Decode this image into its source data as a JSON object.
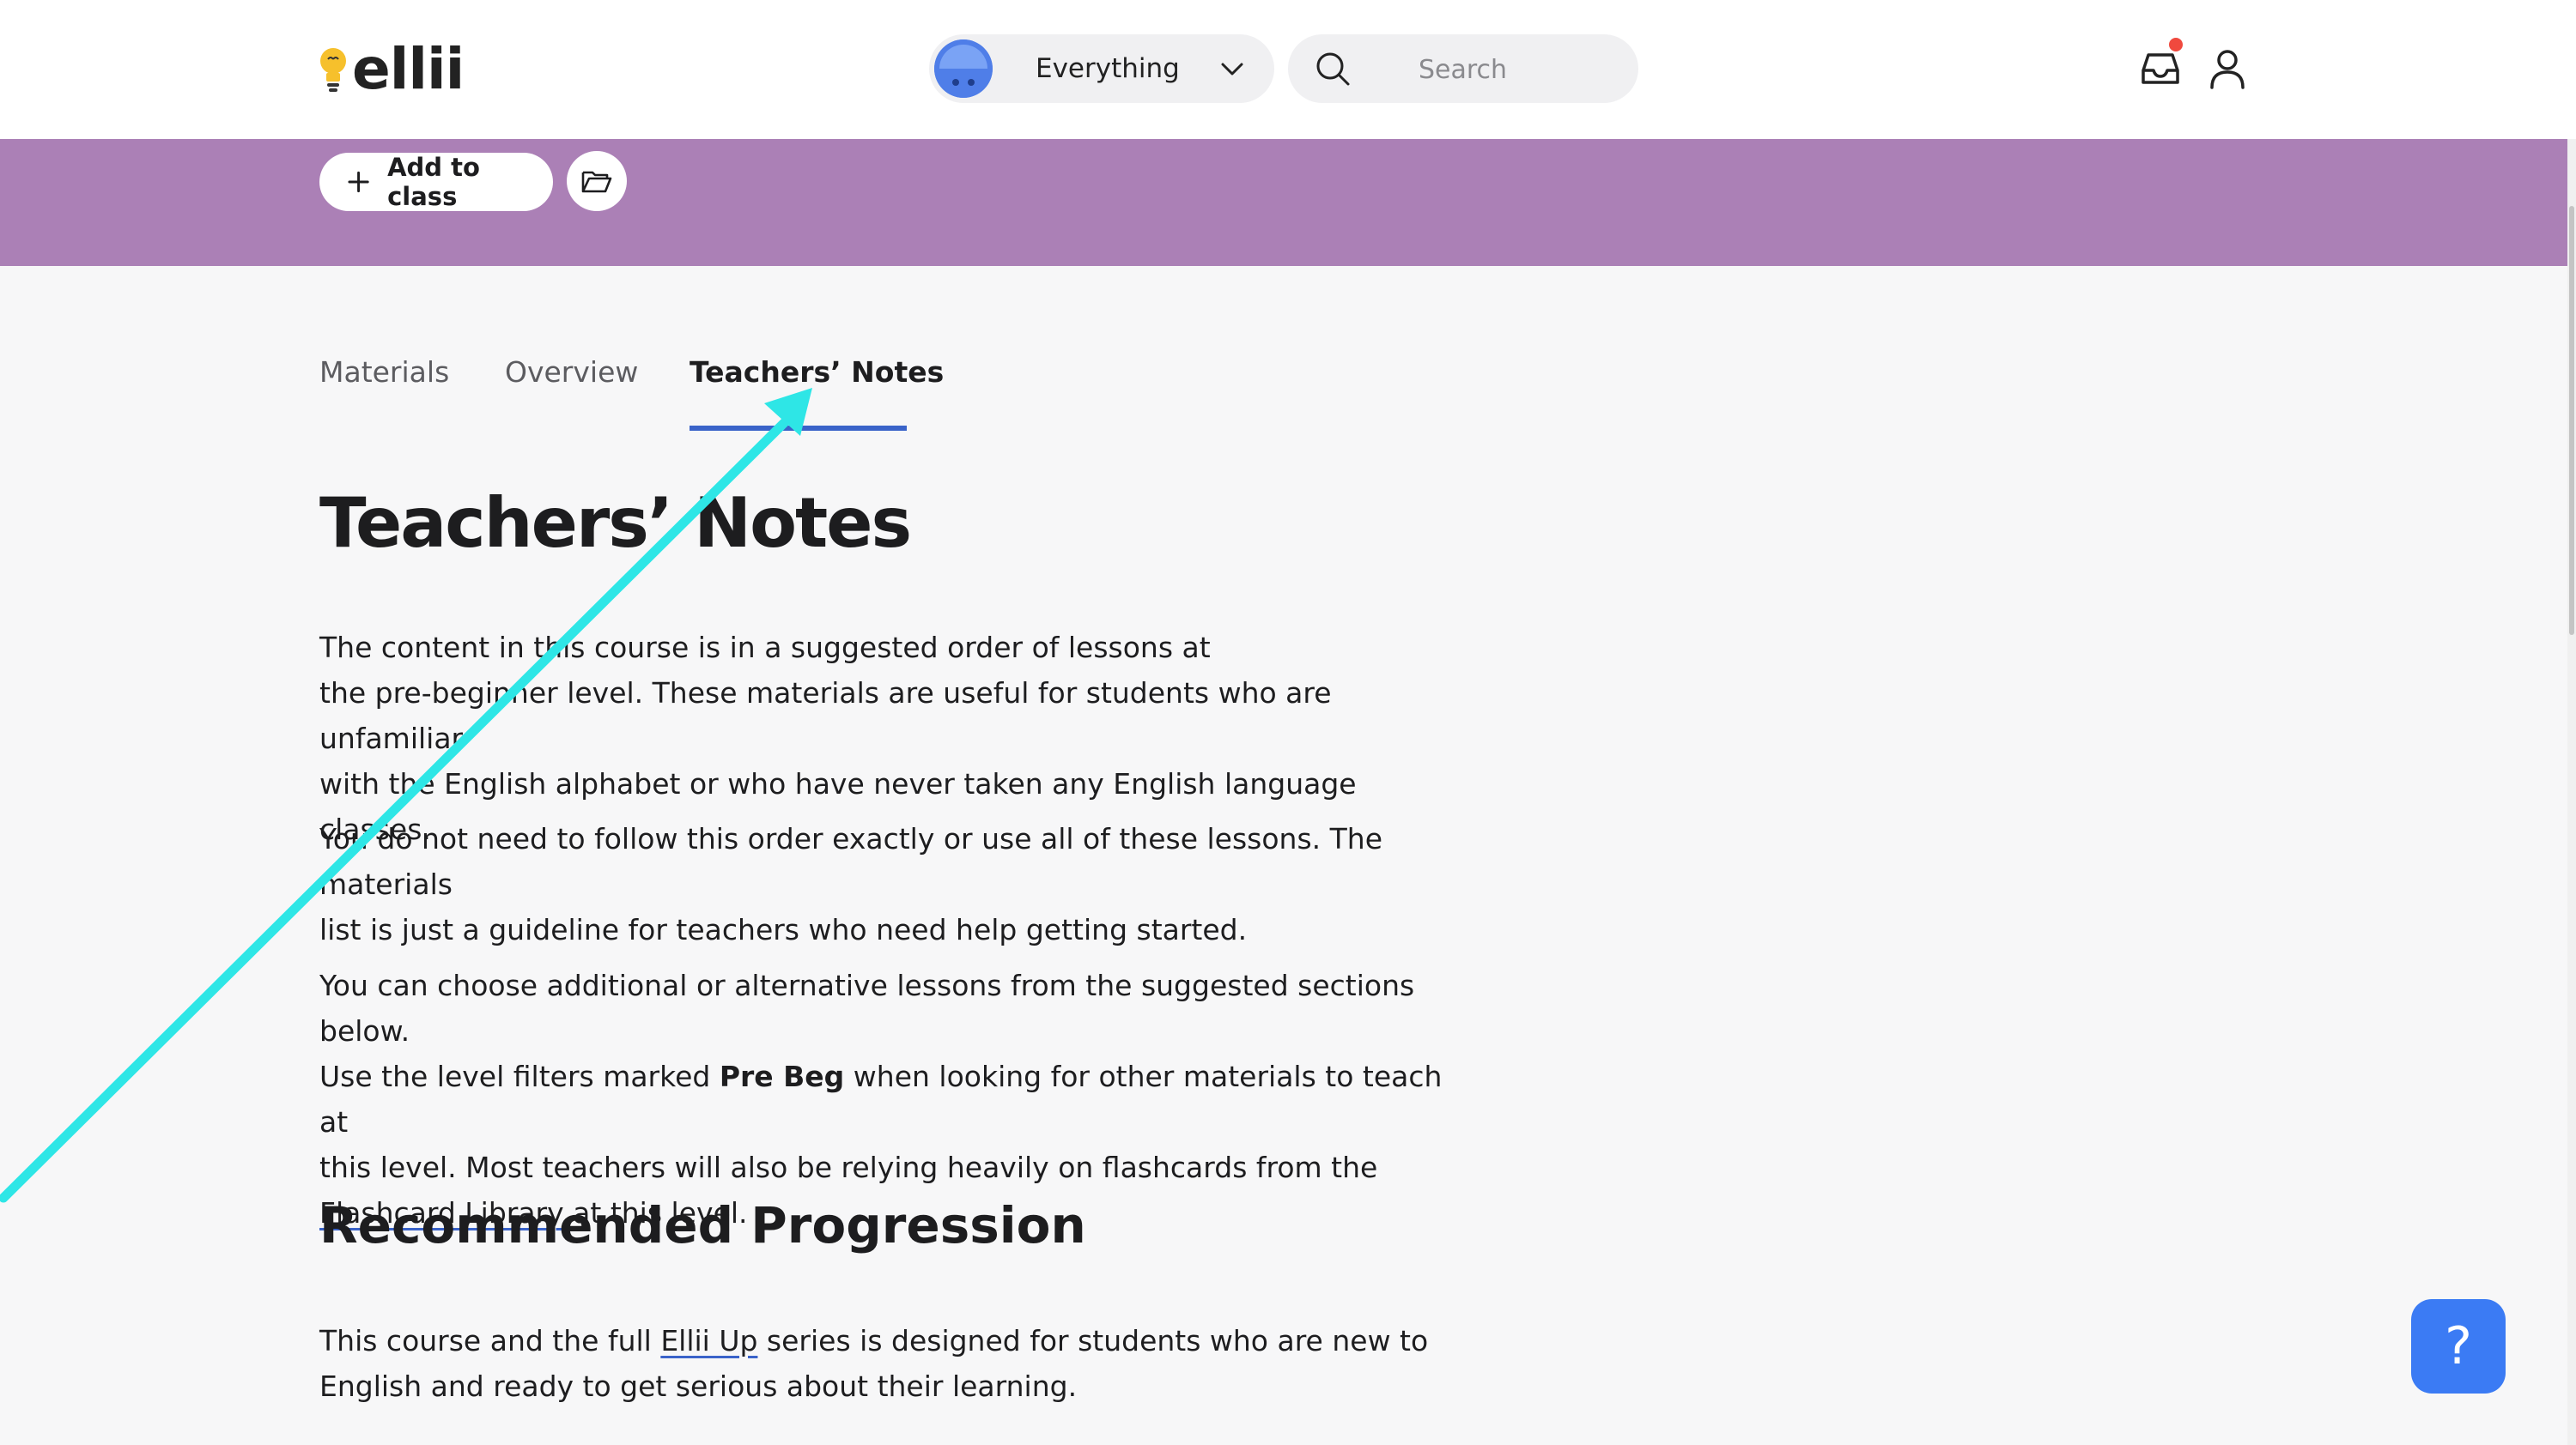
{
  "header": {
    "logo_text": "ellii",
    "scope_label": "Everything",
    "search_placeholder": "Search"
  },
  "toolbar": {
    "add_to_class_label": "Add to class"
  },
  "tabs": [
    {
      "label": "Materials",
      "active": false
    },
    {
      "label": "Overview",
      "active": false
    },
    {
      "label": "Teachers’ Notes",
      "active": true
    }
  ],
  "content": {
    "title": "Teachers’ Notes",
    "p1_line1": "The content in this course is in a suggested order of lessons at",
    "p1_line2": "the pre-beginner level. These materials are useful for students who are unfamiliar",
    "p1_line3": "with the English alphabet or who have never taken any English language classes.",
    "p2_line1": "You do not need to follow this order exactly or use all of these lessons. The materials",
    "p2_line2": "list is just a guideline for teachers who need help getting started.",
    "p3_part1": "You can choose additional or alternative lessons from the suggested sections below.",
    "p3_part2": "Use the level filters marked ",
    "p3_bold": "Pre Beg",
    "p3_part3": " when looking for other materials to teach at",
    "p3_part4": "this level. Most teachers will also be relying heavily on flashcards from the ",
    "p3_link": "Flashcard Library",
    "p3_part5": " at this level.",
    "h2": "Recommended Progression",
    "p4_part1": "This course and the full ",
    "p4_link": "Ellii Up",
    "p4_part2": " series is designed for students who are new to",
    "p4_part3": "English and ready to get serious about their learning."
  },
  "help_label": "?",
  "colors": {
    "band": "#ab80b6",
    "accent": "#3a63c9",
    "help": "#3b7bf4",
    "annotation_arrow": "#2ee6e6"
  }
}
